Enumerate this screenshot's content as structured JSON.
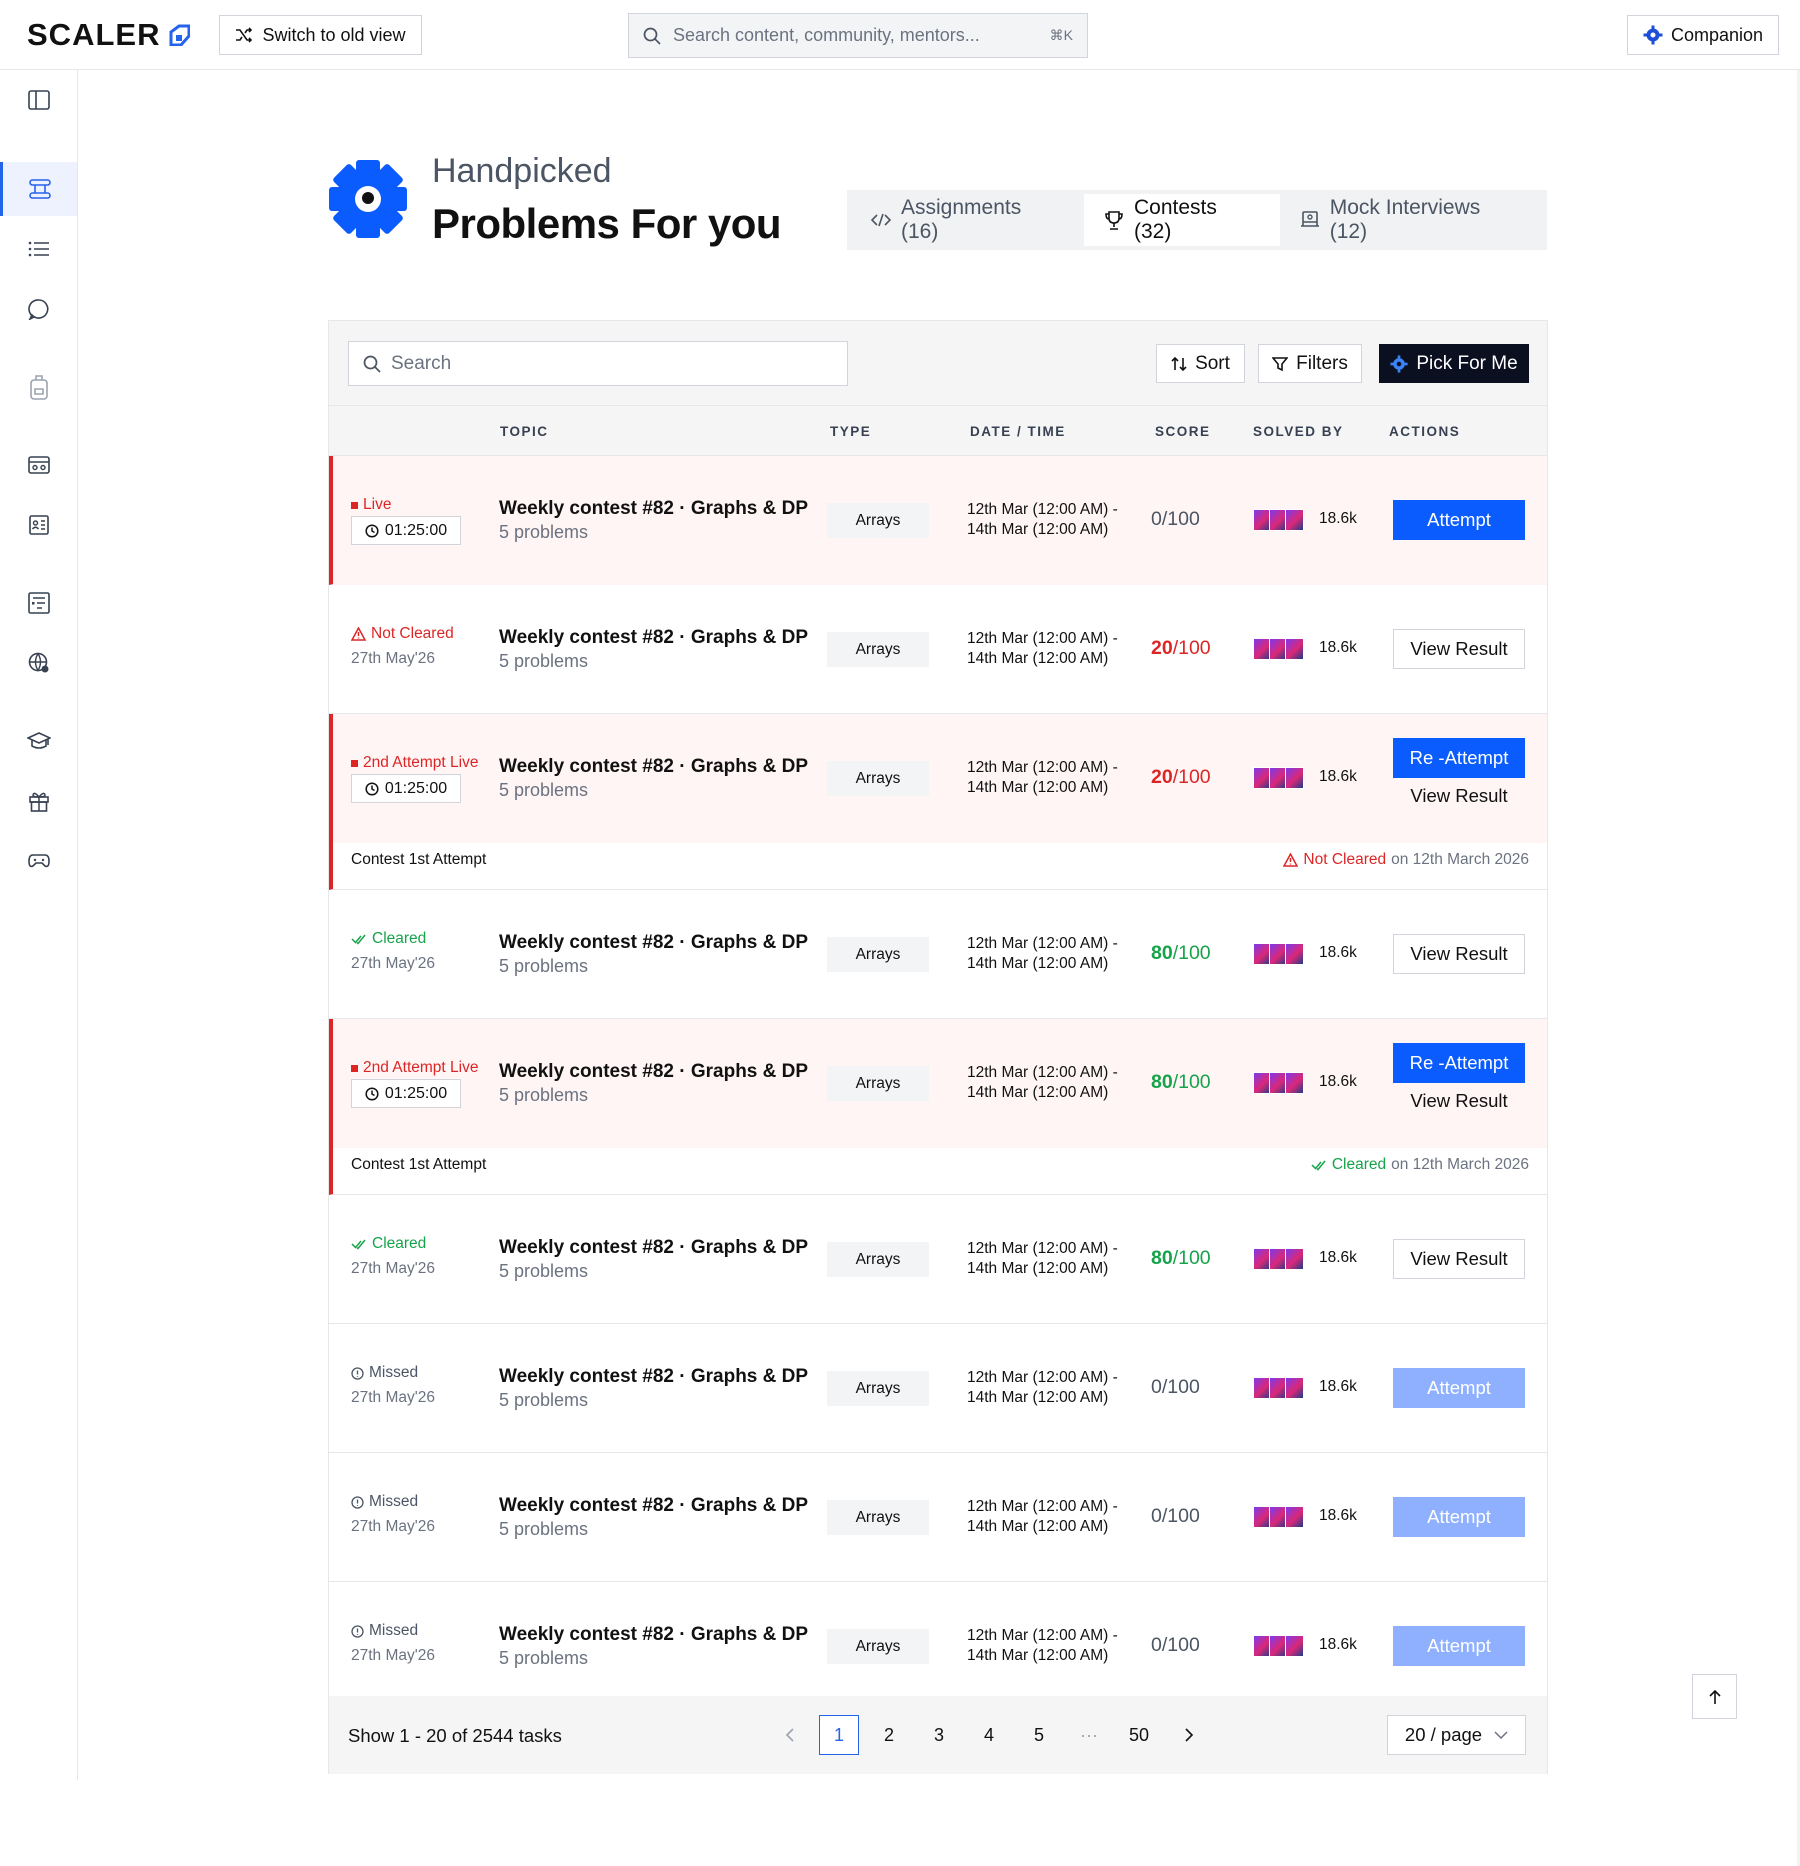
{
  "topbar": {
    "brand": "SCALER",
    "switch_label": "Switch to old view",
    "search_placeholder": "Search content, community, mentors...",
    "search_shortcut": "⌘K",
    "companion_label": "Companion"
  },
  "sidebar": {
    "items": [
      {
        "icon": "sidebar-toggle-icon"
      },
      {
        "icon": "problems-icon",
        "active": true
      },
      {
        "icon": "list-icon"
      },
      {
        "icon": "chat-icon"
      },
      {
        "icon": "backpack-icon"
      },
      {
        "icon": "video-card-icon"
      },
      {
        "icon": "profile-card-icon"
      },
      {
        "icon": "notes-icon"
      },
      {
        "icon": "globe-icon"
      },
      {
        "icon": "graduation-icon"
      },
      {
        "icon": "gift-icon"
      },
      {
        "icon": "game-controller-icon"
      }
    ]
  },
  "header": {
    "subtitle": "Handpicked",
    "title": "Problems For you",
    "tabs": [
      {
        "label": "Assignments (16)",
        "icon": "code-icon",
        "active": false
      },
      {
        "label": "Contests (32)",
        "icon": "trophy-icon",
        "active": true
      },
      {
        "label": "Mock Interviews (12)",
        "icon": "interview-icon",
        "active": false
      }
    ]
  },
  "toolbar": {
    "search_placeholder": "Search",
    "sort_label": "Sort",
    "filters_label": "Filters",
    "pick_label": "Pick For Me"
  },
  "table": {
    "columns": [
      "TOPIC",
      "TYPE",
      "DATE / TIME",
      "SCORE",
      "SOLVED BY",
      "ACTIONS"
    ],
    "rows": [
      {
        "status": "Live",
        "kind": "live",
        "timer": "01:25:00",
        "title": "Weekly contest #82 · Graphs & DP",
        "sub": "5 problems",
        "type": "Arrays",
        "dt1": "12th Mar (12:00 AM) -",
        "dt2": "14th Mar (12:00 AM)",
        "score_n": "0",
        "score_d": "/100",
        "score_color": "gray",
        "solved": "18.6k",
        "actions": [
          {
            "label": "Attempt",
            "style": "primary"
          }
        ]
      },
      {
        "status": "Not Cleared",
        "kind": "notcleared",
        "date": "27th May'26",
        "title": "Weekly contest #82 · Graphs & DP",
        "sub": "5 problems",
        "type": "Arrays",
        "dt1": "12th Mar (12:00 AM) -",
        "dt2": "14th Mar (12:00 AM)",
        "score_n": "20",
        "score_d": "/100",
        "score_color": "red",
        "solved": "18.6k",
        "actions": [
          {
            "label": "View Result",
            "style": "outline"
          }
        ]
      },
      {
        "status": "2nd Attempt Live",
        "kind": "live",
        "timer": "01:25:00",
        "title": "Weekly contest #82 · Graphs & DP",
        "sub": "5 problems",
        "type": "Arrays",
        "dt1": "12th Mar (12:00 AM) -",
        "dt2": "14th Mar (12:00 AM)",
        "score_n": "20",
        "score_d": "/100",
        "score_color": "red",
        "solved": "18.6k",
        "actions": [
          {
            "label": "Re -Attempt",
            "style": "primary"
          },
          {
            "label": "View Result",
            "style": "link"
          }
        ],
        "note_left": "Contest 1st Attempt",
        "note_status": "Not Cleared",
        "note_status_color": "red",
        "note_date": "on 12th March 2026"
      },
      {
        "status": "Cleared",
        "kind": "cleared",
        "date": "27th May'26",
        "title": "Weekly contest #82 · Graphs & DP",
        "sub": "5 problems",
        "type": "Arrays",
        "dt1": "12th Mar (12:00 AM) -",
        "dt2": "14th Mar (12:00 AM)",
        "score_n": "80",
        "score_d": "/100",
        "score_color": "green",
        "solved": "18.6k",
        "actions": [
          {
            "label": "View Result",
            "style": "outline"
          }
        ]
      },
      {
        "status": "2nd Attempt Live",
        "kind": "live",
        "timer": "01:25:00",
        "title": "Weekly contest #82 · Graphs & DP",
        "sub": "5 problems",
        "type": "Arrays",
        "dt1": "12th Mar (12:00 AM) -",
        "dt2": "14th Mar (12:00 AM)",
        "score_n": "80",
        "score_d": "/100",
        "score_color": "green",
        "solved": "18.6k",
        "actions": [
          {
            "label": "Re -Attempt",
            "style": "primary"
          },
          {
            "label": "View Result",
            "style": "link"
          }
        ],
        "note_left": "Contest 1st Attempt",
        "note_status": "Cleared",
        "note_status_color": "green",
        "note_date": "on 12th March 2026"
      },
      {
        "status": "Cleared",
        "kind": "cleared",
        "date": "27th May'26",
        "title": "Weekly contest #82 · Graphs & DP",
        "sub": "5 problems",
        "type": "Arrays",
        "dt1": "12th Mar (12:00 AM) -",
        "dt2": "14th Mar (12:00 AM)",
        "score_n": "80",
        "score_d": "/100",
        "score_color": "green",
        "solved": "18.6k",
        "actions": [
          {
            "label": "View Result",
            "style": "outline"
          }
        ]
      },
      {
        "status": "Missed",
        "kind": "missed",
        "date": "27th May'26",
        "title": "Weekly contest #82 · Graphs & DP",
        "sub": "5 problems",
        "type": "Arrays",
        "dt1": "12th Mar (12:00 AM) -",
        "dt2": "14th Mar (12:00 AM)",
        "score_n": "0",
        "score_d": "/100",
        "score_color": "gray",
        "solved": "18.6k",
        "actions": [
          {
            "label": "Attempt",
            "style": "faded"
          }
        ]
      },
      {
        "status": "Missed",
        "kind": "missed",
        "date": "27th May'26",
        "title": "Weekly contest #82 · Graphs & DP",
        "sub": "5 problems",
        "type": "Arrays",
        "dt1": "12th Mar (12:00 AM) -",
        "dt2": "14th Mar (12:00 AM)",
        "score_n": "0",
        "score_d": "/100",
        "score_color": "gray",
        "solved": "18.6k",
        "actions": [
          {
            "label": "Attempt",
            "style": "faded"
          }
        ]
      },
      {
        "status": "Missed",
        "kind": "missed",
        "date": "27th May'26",
        "title": "Weekly contest #82 · Graphs & DP",
        "sub": "5 problems",
        "type": "Arrays",
        "dt1": "12th Mar (12:00 AM) -",
        "dt2": "14th Mar (12:00 AM)",
        "score_n": "0",
        "score_d": "/100",
        "score_color": "gray",
        "solved": "18.6k",
        "actions": [
          {
            "label": "Attempt",
            "style": "faded"
          }
        ]
      }
    ]
  },
  "footer": {
    "show_text": "Show 1 - 20 of 2544 tasks",
    "pages": [
      "1",
      "2",
      "3",
      "4",
      "5",
      "···",
      "50"
    ],
    "current_page": "1",
    "per_page": "20 / page"
  },
  "colors": {
    "primary": "#0b5cff",
    "danger": "#dc2626",
    "success": "#16a34a",
    "dark": "#0b1020"
  }
}
